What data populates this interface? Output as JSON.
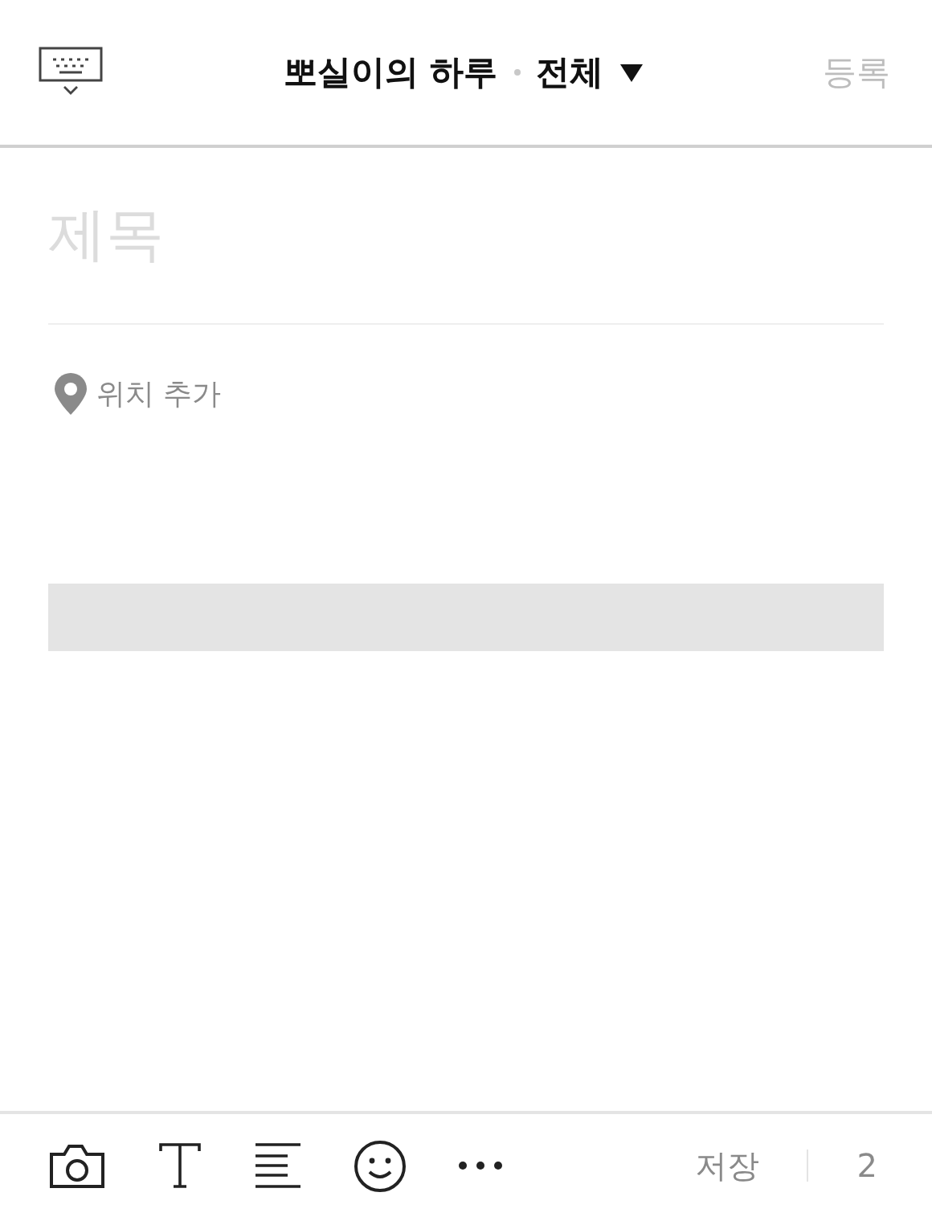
{
  "header": {
    "blog_title": "뽀실이의 하루",
    "category": "전체",
    "submit": {
      "label": "등록",
      "disabled": true
    }
  },
  "editor": {
    "title_placeholder": "제목",
    "location": "위치 추가",
    "blocks": [
      {
        "kind": "blank"
      }
    ]
  },
  "toolbar": {
    "tools": [
      {
        "kind": "camera"
      },
      {
        "kind": "text"
      },
      {
        "kind": "align"
      },
      {
        "kind": "emoji"
      },
      {
        "kind": "more"
      }
    ],
    "save": "저장",
    "count": "2"
  }
}
